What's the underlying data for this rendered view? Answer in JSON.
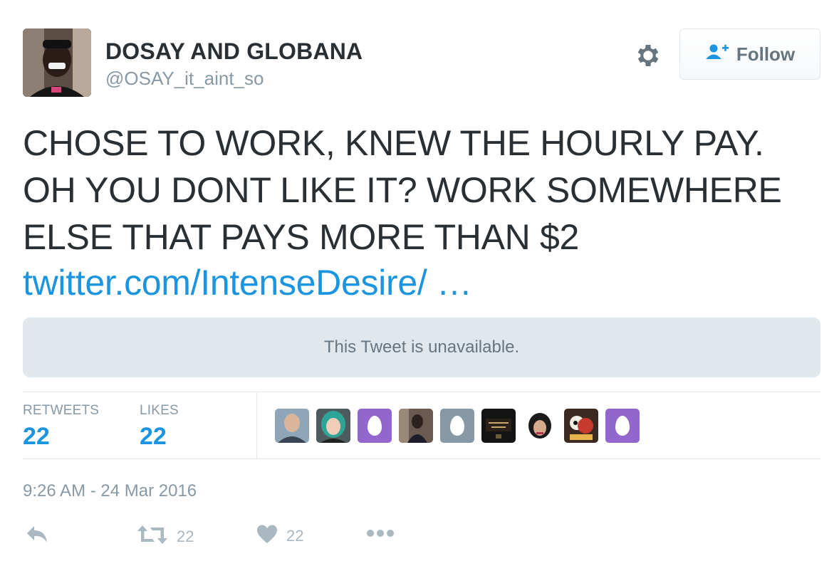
{
  "author": {
    "display_name": "DOSAY AND GLOBANA",
    "handle": "@OSAY_it_aint_so"
  },
  "header": {
    "follow_label": "Follow"
  },
  "tweet": {
    "text": "CHOSE TO WORK, KNEW THE HOURLY PAY. OH YOU DONT LIKE IT? WORK SOMEWHERE ELSE THAT PAYS MORE THAN $2",
    "link": "twitter.com/IntenseDesire/ …",
    "quoted_unavailable": "This Tweet is unavailable.",
    "timestamp": "9:26 AM - 24 Mar 2016"
  },
  "stats": {
    "retweets_label": "RETWEETS",
    "retweets": "22",
    "likes_label": "LIKES",
    "likes": "22"
  },
  "actions": {
    "retweet_count": "22",
    "like_count": "22"
  },
  "colors": {
    "link_blue": "#1b95e0",
    "muted_gray": "#8899a6",
    "text_dark": "#292f33",
    "egg_purple": "#9266cc",
    "egg_gray": "#8899a6"
  }
}
